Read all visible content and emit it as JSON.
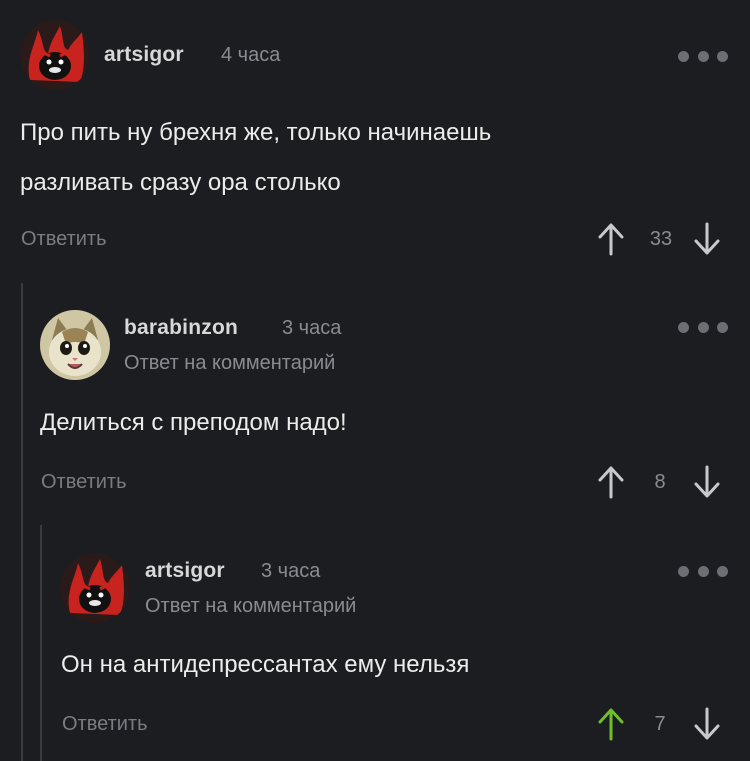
{
  "comments": [
    {
      "username": "artsigor",
      "time": "4 часа",
      "reply_to": "",
      "text": "Про пить ну брехня же, только начинаешь\nразливать сразу ора столько",
      "reply_label": "Ответить",
      "score": "33",
      "upvoted": false
    },
    {
      "username": "barabinzon",
      "time": "3 часа",
      "reply_to": "Ответ на комментарий",
      "text": "Делиться с преподом надо!",
      "reply_label": "Ответить",
      "score": "8",
      "upvoted": false
    },
    {
      "username": "artsigor",
      "time": "3 часа",
      "reply_to": "Ответ на комментарий",
      "text": "Он на антидепрессантах ему нельзя",
      "reply_label": "Ответить",
      "score": "7",
      "upvoted": true
    }
  ],
  "colors": {
    "background": "#1c1d20",
    "upvote_active": "#6fbf2a",
    "arrow": "#c9c9cc"
  },
  "icons": [
    "avatar-artsigor",
    "avatar-cat",
    "more-icon",
    "upvote-icon",
    "downvote-icon"
  ]
}
